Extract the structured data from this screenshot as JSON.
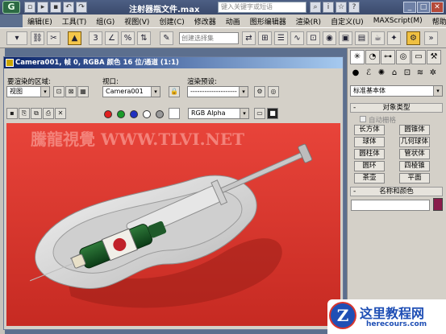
{
  "titlebar": {
    "file_title": "注射器瓶文件.max",
    "search_placeholder": "键入关键字或短语",
    "win_min": "_",
    "win_max": "□",
    "win_close": "✕"
  },
  "menubar": {
    "items": [
      "编辑(E)",
      "工具(T)",
      "组(G)",
      "视图(V)",
      "创建(C)",
      "修改器",
      "动画",
      "图形编辑器",
      "渲染(R)",
      "自定义(U)",
      "MAXScript(M)",
      "帮助(H)"
    ]
  },
  "main_toolbar": {
    "selection_set_placeholder": "创建选择集"
  },
  "render_window": {
    "title": "Camera001, 帧 0, RGBA 颜色 16 位/通道 (1:1)",
    "area_label": "要渲染的区域:",
    "area_value": "视图",
    "viewport_label": "视口:",
    "viewport_value": "Camera001",
    "preset_label": "渲染预设:",
    "preset_value": "--------------------",
    "channel_value": "RGB Alpha",
    "watermark": "騰龍視覺 WWW.TLVI.NET"
  },
  "command_panel": {
    "category": "标准基本体",
    "object_type_title": "对象类型",
    "autogrid_label": "自动栅格",
    "objects": [
      "长方体",
      "圆锥体",
      "球体",
      "几何球体",
      "圆柱体",
      "管状体",
      "圆环",
      "四棱锥",
      "茶壶",
      "平面"
    ],
    "name_color_title": "名称和颜色",
    "collapse_symbol": "-"
  },
  "site_logo": {
    "letter": "Z",
    "name": "这里教程网",
    "url": "herecours.com"
  },
  "colors": {
    "viewport_bg": "#d9362e",
    "titlebar": "#0a246a",
    "swatch": "#8a1c4a",
    "logo_blue": "#1f4fb5"
  }
}
